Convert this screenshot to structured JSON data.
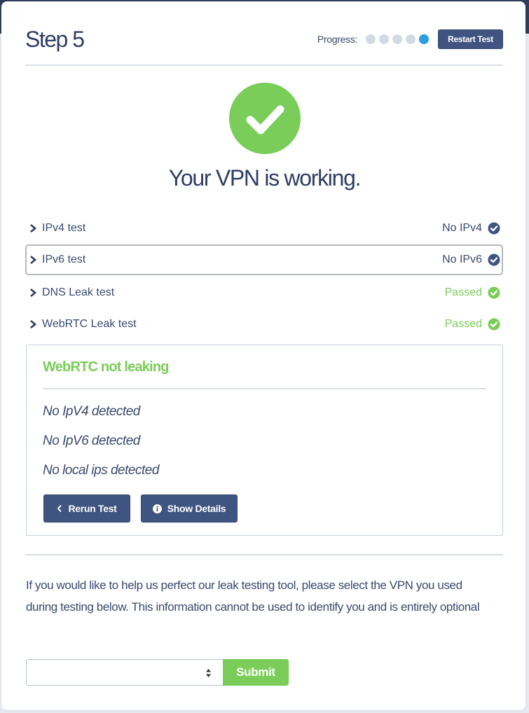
{
  "header": {
    "title": "Step 5",
    "progress_label": "Progress:",
    "progress": {
      "current_step": 5,
      "total_steps": 5
    },
    "restart_label": "Restart Test"
  },
  "result": {
    "icon": "check-circle-icon",
    "headline": "Your VPN is working."
  },
  "tests": [
    {
      "label": "IPv4 test",
      "status": "No IPv4",
      "status_color": "#3f5481",
      "icon": "check-circle-icon"
    },
    {
      "label": "IPv6 test",
      "status": "No IPv6",
      "status_color": "#3f5481",
      "icon": "check-circle-icon"
    },
    {
      "label": "DNS Leak test",
      "status": "Passed",
      "status_color": "#7acd58",
      "icon": "check-circle-icon"
    },
    {
      "label": "WebRTC Leak test",
      "status": "Passed",
      "status_color": "#7acd58",
      "icon": "check-circle-icon"
    }
  ],
  "webrtc_panel": {
    "title": "WebRTC not leaking",
    "lines": [
      "No IpV4 detected",
      "No IpV6 detected",
      "No local ips detected"
    ],
    "rerun_label": "Rerun Test",
    "details_label": "Show Details"
  },
  "feedback": {
    "text": "If you would like to help us perfect our leak testing tool, please select the VPN you used during testing below. This information cannot be used to identify you and is entirely optional",
    "select_value": "",
    "submit_label": "Submit"
  },
  "colors": {
    "primary": "#3f5481",
    "success": "#7acd58",
    "progress_active": "#2a9ee3",
    "progress_inactive": "#d1dbe5"
  }
}
